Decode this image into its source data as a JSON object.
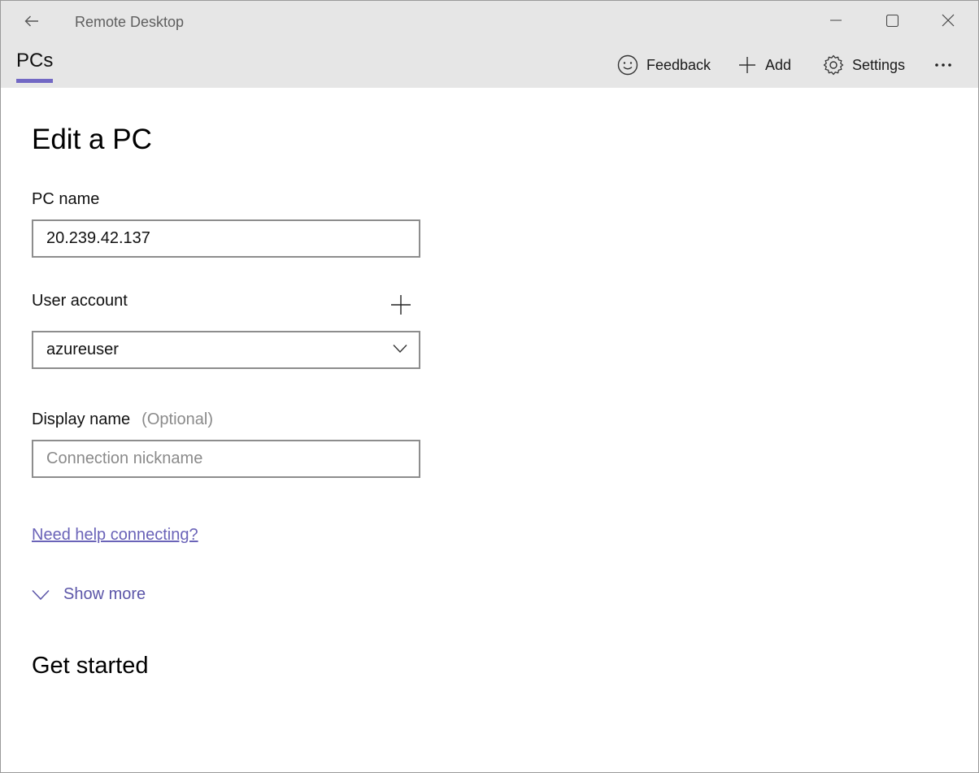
{
  "window": {
    "title": "Remote Desktop"
  },
  "nav": {
    "tab_pcs": "PCs",
    "feedback": "Feedback",
    "add": "Add",
    "settings": "Settings",
    "more": "···"
  },
  "form": {
    "heading": "Edit a PC",
    "pc_name_label": "PC name",
    "pc_name_value": "20.239.42.137",
    "user_account_label": "User account",
    "user_account_value": "azureuser",
    "display_name_label": "Display name",
    "display_name_optional": "(Optional)",
    "display_name_placeholder": "Connection nickname",
    "help_link": "Need help connecting?",
    "show_more": "Show more"
  },
  "sections": {
    "get_started": "Get started"
  },
  "colors": {
    "accent": "#7268c4",
    "link": "#6a63b8",
    "chrome_bg": "#e6e6e6"
  },
  "icons": {
    "back": "arrow-left-icon",
    "minimize": "minimize-icon",
    "maximize": "maximize-icon",
    "close": "close-icon",
    "feedback": "smiley-icon",
    "add": "plus-icon",
    "settings": "gear-icon",
    "more": "ellipsis-icon",
    "dropdown": "chevron-down-icon"
  }
}
